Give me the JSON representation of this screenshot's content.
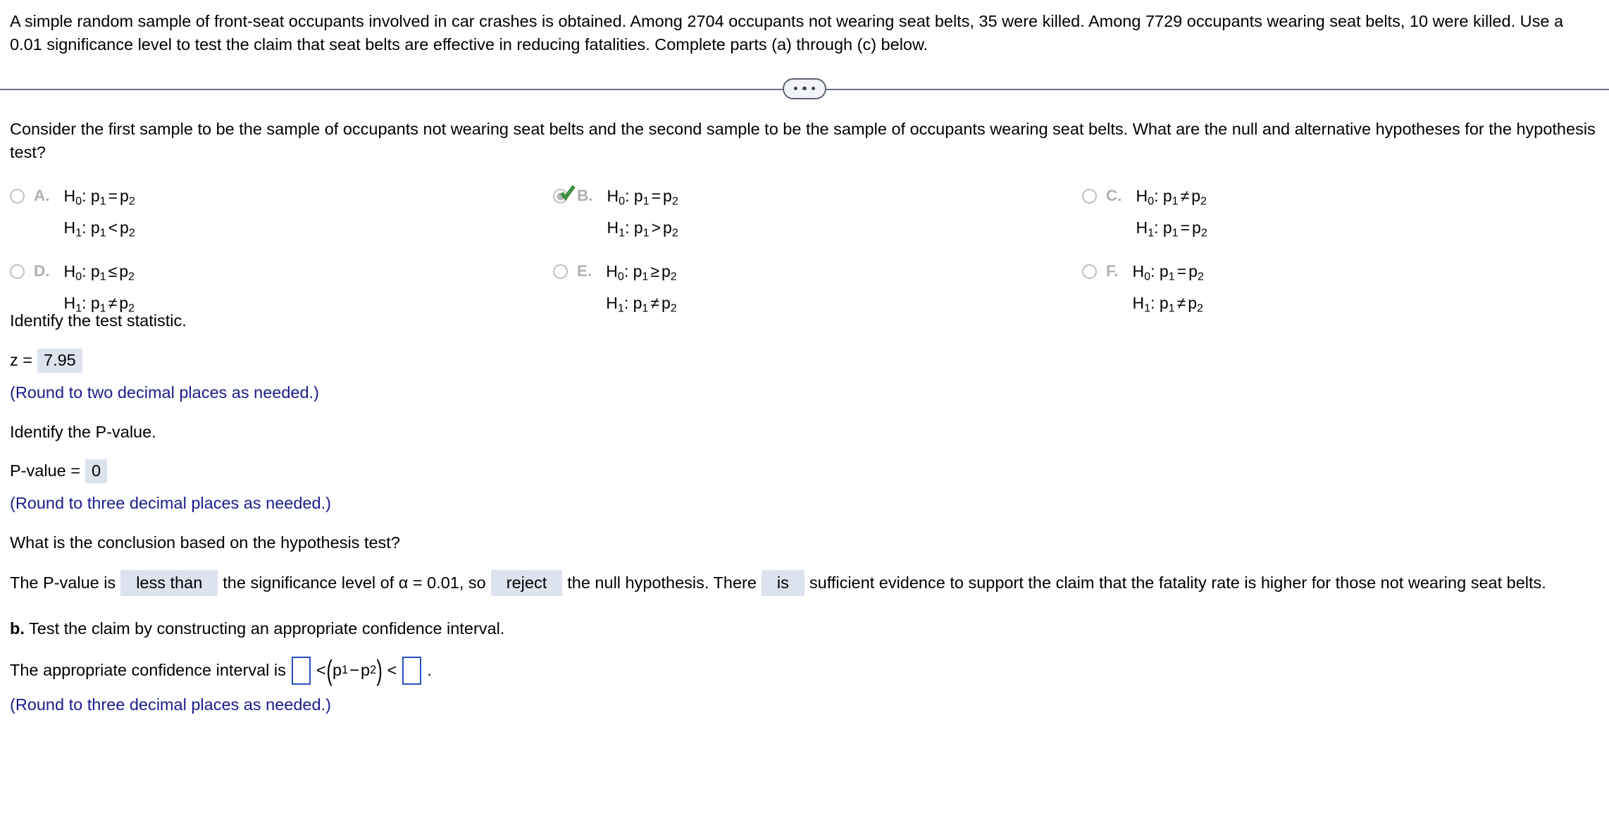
{
  "problem": {
    "statement": "A simple random sample of front-seat occupants involved in car crashes is obtained. Among 2704 occupants not wearing seat belts, 35 were killed. Among 7729 occupants wearing seat belts, 10 were killed. Use a 0.01 significance level to test the claim that seat belts are effective in reducing fatalities. Complete parts (a) through (c) below."
  },
  "divider": {
    "dots_label": "..."
  },
  "part_a": {
    "question": "Consider the first sample to be the sample of occupants not wearing seat belts and the second sample to be the sample of occupants wearing seat belts. What are the null and alternative hypotheses for the hypothesis test?",
    "options": [
      {
        "letter": "A.",
        "selected": false,
        "h0": {
          "label": "H",
          "sub": "0",
          "colon": ":",
          "left": "p",
          "left_sub": "1",
          "operator": "=",
          "right": "p",
          "right_sub": "2"
        },
        "h1": {
          "label": "H",
          "sub": "1",
          "colon": ":",
          "left": "p",
          "left_sub": "1",
          "operator": "<",
          "right": "p",
          "right_sub": "2"
        }
      },
      {
        "letter": "B.",
        "selected": true,
        "h0": {
          "label": "H",
          "sub": "0",
          "colon": ":",
          "left": "p",
          "left_sub": "1",
          "operator": "=",
          "right": "p",
          "right_sub": "2"
        },
        "h1": {
          "label": "H",
          "sub": "1",
          "colon": ":",
          "left": "p",
          "left_sub": "1",
          "operator": ">",
          "right": "p",
          "right_sub": "2"
        }
      },
      {
        "letter": "C.",
        "selected": false,
        "h0": {
          "label": "H",
          "sub": "0",
          "colon": ":",
          "left": "p",
          "left_sub": "1",
          "operator": "≠",
          "right": "p",
          "right_sub": "2"
        },
        "h1": {
          "label": "H",
          "sub": "1",
          "colon": ":",
          "left": "p",
          "left_sub": "1",
          "operator": "=",
          "right": "p",
          "right_sub": "2"
        }
      },
      {
        "letter": "D.",
        "selected": false,
        "h0": {
          "label": "H",
          "sub": "0",
          "colon": ":",
          "left": "p",
          "left_sub": "1",
          "operator": "≤",
          "right": "p",
          "right_sub": "2"
        },
        "h1": {
          "label": "H",
          "sub": "1",
          "colon": ":",
          "left": "p",
          "left_sub": "1",
          "operator": "≠",
          "right": "p",
          "right_sub": "2"
        }
      },
      {
        "letter": "E.",
        "selected": false,
        "h0": {
          "label": "H",
          "sub": "0",
          "colon": ":",
          "left": "p",
          "left_sub": "1",
          "operator": "≥",
          "right": "p",
          "right_sub": "2"
        },
        "h1": {
          "label": "H",
          "sub": "1",
          "colon": ":",
          "left": "p",
          "left_sub": "1",
          "operator": "≠",
          "right": "p",
          "right_sub": "2"
        }
      },
      {
        "letter": "F.",
        "selected": false,
        "h0": {
          "label": "H",
          "sub": "0",
          "colon": ":",
          "left": "p",
          "left_sub": "1",
          "operator": "=",
          "right": "p",
          "right_sub": "2"
        },
        "h1": {
          "label": "H",
          "sub": "1",
          "colon": ":",
          "left": "p",
          "left_sub": "1",
          "operator": "≠",
          "right": "p",
          "right_sub": "2"
        }
      }
    ],
    "test_statistic": {
      "prompt": "Identify the test statistic.",
      "label": "z =",
      "value": "7.95",
      "note": "(Round to two decimal places as needed.)"
    },
    "p_value": {
      "prompt": "Identify the P-value.",
      "label": "P-value =",
      "value": "0",
      "note": "(Round to three decimal places as needed.)"
    },
    "conclusion": {
      "prompt": "What is the conclusion based on the hypothesis test?",
      "text_1": "The P-value is",
      "choice_1": "less than",
      "text_2": "the significance level of α = 0.01, so",
      "choice_2": "reject",
      "text_3": "the null hypothesis. There",
      "choice_3": "is",
      "text_4": "sufficient evidence to support the claim that the fatality rate is higher for those not wearing seat belts."
    }
  },
  "part_b": {
    "heading_bold": "b.",
    "heading_text": " Test the claim by constructing an appropriate confidence interval.",
    "ci_prefix": "The appropriate confidence interval is",
    "ci_lower_value": "",
    "ci_op_left": "<",
    "ci_expr_left": "p",
    "ci_expr_left_sub": "1",
    "ci_expr_minus": "−",
    "ci_expr_right": "p",
    "ci_expr_right_sub": "2",
    "ci_op_right": "<",
    "ci_upper_value": "",
    "ci_period": ".",
    "note": "(Round to three decimal places as needed.)"
  },
  "colors": {
    "note_blue": "#1c1c8c",
    "box_fill": "#dde2ef",
    "input_border": "#2a4fc4",
    "check_green": "#3f9142",
    "divider": "#69707d",
    "option_letter": "#b0b0b0"
  }
}
